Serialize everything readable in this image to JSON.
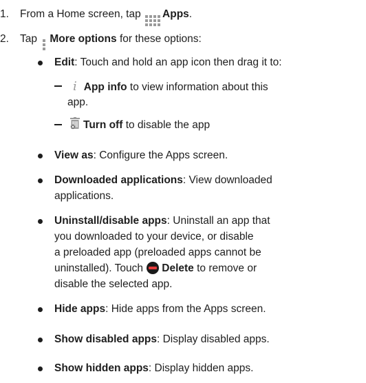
{
  "steps": [
    {
      "number": "1.",
      "text_before": "From a Home screen, tap",
      "icon": "apps-grid-icon",
      "bold": "Apps",
      "text_after": "."
    },
    {
      "number": "2.",
      "text_before": "Tap",
      "icon": "more-options-icon",
      "bold": "More options",
      "text_after": "for these options:"
    }
  ],
  "edit": {
    "bold": "Edit",
    "text": ": Touch and hold an app icon then drag it to:",
    "subitems": [
      {
        "icon": "info-icon",
        "icon_glyph": "i",
        "bold": "App info",
        "text_line1": "to view information about this",
        "text_line2": "app."
      },
      {
        "icon": "trash-icon",
        "bold": "Turn off",
        "text": "to disable the app"
      }
    ]
  },
  "options": [
    {
      "bold": "View as",
      "lines": [
        ": Configure the Apps screen."
      ]
    },
    {
      "bold": "Downloaded applications",
      "lines": [
        ": View downloaded",
        "applications."
      ]
    },
    {
      "bold": "Uninstall/disable apps",
      "lines": [
        ": Uninstall an app that",
        "you downloaded to your device, or disable",
        "a preloaded app (preloaded apps cannot be",
        "uninstalled). Touch"
      ],
      "icon": "delete-icon",
      "bold2": "Delete",
      "text_after": "to remove or",
      "last_line": "disable the selected app."
    },
    {
      "bold": "Hide apps",
      "lines": [
        ": Hide apps from the Apps screen."
      ]
    },
    {
      "bold": "Show disabled apps",
      "lines": [
        ": Display disabled apps."
      ]
    },
    {
      "bold": "Show hidden apps",
      "lines": [
        ": Display hidden apps."
      ]
    }
  ],
  "colors": {
    "text": "#1e1e1e",
    "icon_gray": "#9a9a9a",
    "delete_red": "#e23a3a"
  }
}
